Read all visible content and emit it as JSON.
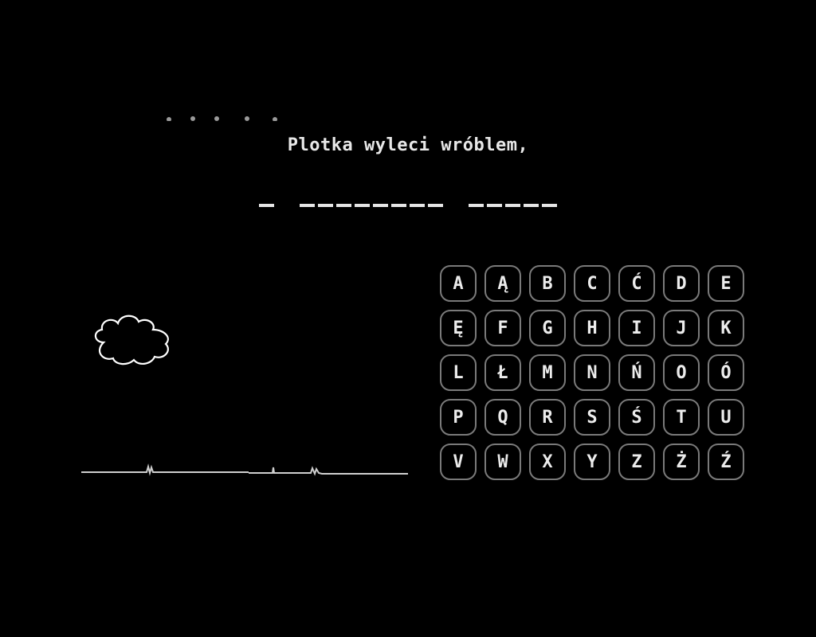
{
  "game": {
    "clue": "Plotka wyleci wróblem,",
    "answer_words": [
      1,
      8,
      5
    ]
  },
  "keyboard": {
    "letters": [
      "A",
      "Ą",
      "B",
      "C",
      "Ć",
      "D",
      "E",
      "Ę",
      "F",
      "G",
      "H",
      "I",
      "J",
      "K",
      "L",
      "Ł",
      "M",
      "N",
      "Ń",
      "O",
      "Ó",
      "P",
      "Q",
      "R",
      "S",
      "Ś",
      "T",
      "U",
      "V",
      "W",
      "X",
      "Y",
      "Z",
      "Ż",
      "Ź"
    ]
  },
  "icons": {
    "cloud": "cloud-icon",
    "ground": "ground-line"
  },
  "colors": {
    "background": "#000000",
    "text": "#e6e6e6",
    "key_border": "#7a7a7a"
  }
}
